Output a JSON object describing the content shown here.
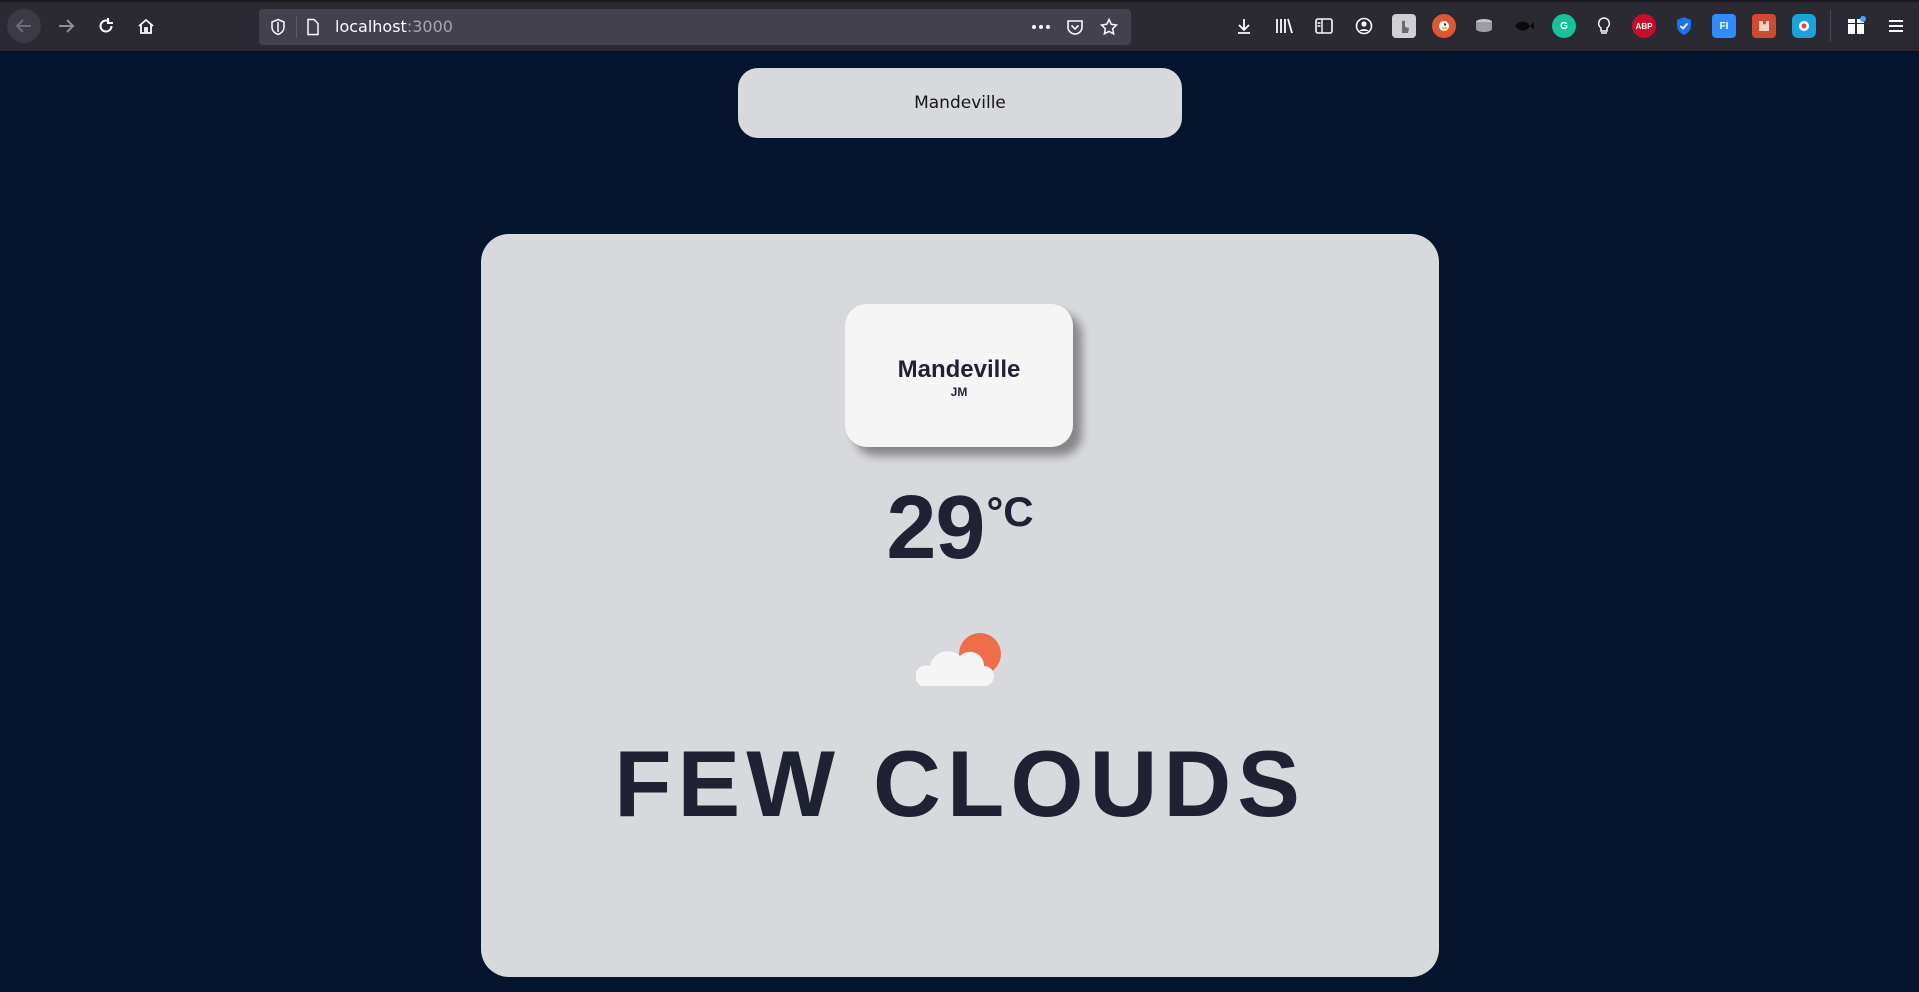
{
  "browser": {
    "url_host": "localhost",
    "url_port": ":3000",
    "nav_icons": [
      "back-arrow-icon",
      "forward-arrow-icon",
      "reload-icon",
      "home-icon"
    ],
    "page_action_icons": [
      "more-icon",
      "pocket-icon",
      "bookmark-star-icon"
    ],
    "toolbar_icons": [
      "download-icon",
      "library-icon",
      "sidebar-icon",
      "account-icon"
    ],
    "extensions": [
      {
        "name": "ext-gesture-icon",
        "label": "",
        "color": "#cfcfd4"
      },
      {
        "name": "ext-duckduckgo-icon",
        "label": "",
        "color": "#de5833"
      },
      {
        "name": "ext-database-icon",
        "label": "",
        "color": "#9c9ca3"
      },
      {
        "name": "ext-fish-icon",
        "label": "",
        "color": "#111111"
      },
      {
        "name": "ext-grammarly-icon",
        "label": "G",
        "color": "#15c39a"
      },
      {
        "name": "ext-bulb-icon",
        "label": "",
        "color": "#2b2a33"
      },
      {
        "name": "ext-adblock-icon",
        "label": "ABP",
        "color": "#c70d2c"
      },
      {
        "name": "ext-shield-icon",
        "label": "",
        "color": "#1a73e8"
      },
      {
        "name": "ext-fi-icon",
        "label": "FI",
        "color": "#2f8cff"
      },
      {
        "name": "ext-puzzle-red-icon",
        "label": "",
        "color": "#d04a32"
      },
      {
        "name": "ext-target-icon",
        "label": "",
        "color": "#1aa3d9"
      }
    ]
  },
  "search": {
    "value": "Mandeville",
    "placeholder": ""
  },
  "weather": {
    "city": "Mandeville",
    "country": "JM",
    "temperature": "29",
    "unit": "°C",
    "condition": "FEW CLOUDS",
    "icon": "few-clouds-icon"
  },
  "colors": {
    "page_bg": "#06152e",
    "card_bg": "#d8d9dd",
    "text": "#1f2233",
    "sun": "#ee6e49"
  }
}
